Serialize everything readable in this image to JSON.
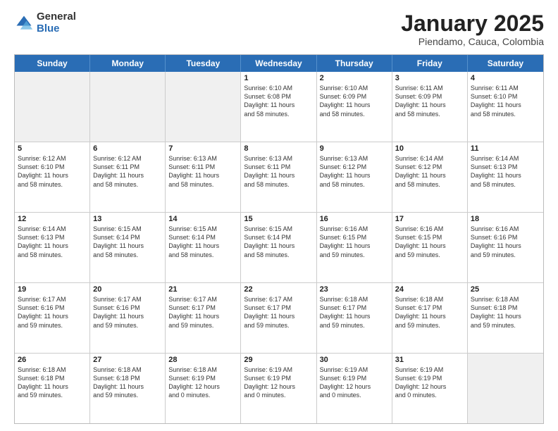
{
  "logo": {
    "general": "General",
    "blue": "Blue"
  },
  "title": {
    "month": "January 2025",
    "location": "Piendamo, Cauca, Colombia"
  },
  "header_days": [
    "Sunday",
    "Monday",
    "Tuesday",
    "Wednesday",
    "Thursday",
    "Friday",
    "Saturday"
  ],
  "weeks": [
    [
      {
        "day": "",
        "info": "",
        "shaded": true,
        "empty": true
      },
      {
        "day": "",
        "info": "",
        "shaded": true,
        "empty": true
      },
      {
        "day": "",
        "info": "",
        "shaded": true,
        "empty": true
      },
      {
        "day": "1",
        "info": "Sunrise: 6:10 AM\nSunset: 6:08 PM\nDaylight: 11 hours\nand 58 minutes."
      },
      {
        "day": "2",
        "info": "Sunrise: 6:10 AM\nSunset: 6:09 PM\nDaylight: 11 hours\nand 58 minutes."
      },
      {
        "day": "3",
        "info": "Sunrise: 6:11 AM\nSunset: 6:09 PM\nDaylight: 11 hours\nand 58 minutes."
      },
      {
        "day": "4",
        "info": "Sunrise: 6:11 AM\nSunset: 6:10 PM\nDaylight: 11 hours\nand 58 minutes."
      }
    ],
    [
      {
        "day": "5",
        "info": "Sunrise: 6:12 AM\nSunset: 6:10 PM\nDaylight: 11 hours\nand 58 minutes."
      },
      {
        "day": "6",
        "info": "Sunrise: 6:12 AM\nSunset: 6:11 PM\nDaylight: 11 hours\nand 58 minutes."
      },
      {
        "day": "7",
        "info": "Sunrise: 6:13 AM\nSunset: 6:11 PM\nDaylight: 11 hours\nand 58 minutes."
      },
      {
        "day": "8",
        "info": "Sunrise: 6:13 AM\nSunset: 6:11 PM\nDaylight: 11 hours\nand 58 minutes."
      },
      {
        "day": "9",
        "info": "Sunrise: 6:13 AM\nSunset: 6:12 PM\nDaylight: 11 hours\nand 58 minutes."
      },
      {
        "day": "10",
        "info": "Sunrise: 6:14 AM\nSunset: 6:12 PM\nDaylight: 11 hours\nand 58 minutes."
      },
      {
        "day": "11",
        "info": "Sunrise: 6:14 AM\nSunset: 6:13 PM\nDaylight: 11 hours\nand 58 minutes."
      }
    ],
    [
      {
        "day": "12",
        "info": "Sunrise: 6:14 AM\nSunset: 6:13 PM\nDaylight: 11 hours\nand 58 minutes."
      },
      {
        "day": "13",
        "info": "Sunrise: 6:15 AM\nSunset: 6:14 PM\nDaylight: 11 hours\nand 58 minutes."
      },
      {
        "day": "14",
        "info": "Sunrise: 6:15 AM\nSunset: 6:14 PM\nDaylight: 11 hours\nand 58 minutes."
      },
      {
        "day": "15",
        "info": "Sunrise: 6:15 AM\nSunset: 6:14 PM\nDaylight: 11 hours\nand 58 minutes."
      },
      {
        "day": "16",
        "info": "Sunrise: 6:16 AM\nSunset: 6:15 PM\nDaylight: 11 hours\nand 59 minutes."
      },
      {
        "day": "17",
        "info": "Sunrise: 6:16 AM\nSunset: 6:15 PM\nDaylight: 11 hours\nand 59 minutes."
      },
      {
        "day": "18",
        "info": "Sunrise: 6:16 AM\nSunset: 6:16 PM\nDaylight: 11 hours\nand 59 minutes."
      }
    ],
    [
      {
        "day": "19",
        "info": "Sunrise: 6:17 AM\nSunset: 6:16 PM\nDaylight: 11 hours\nand 59 minutes."
      },
      {
        "day": "20",
        "info": "Sunrise: 6:17 AM\nSunset: 6:16 PM\nDaylight: 11 hours\nand 59 minutes."
      },
      {
        "day": "21",
        "info": "Sunrise: 6:17 AM\nSunset: 6:17 PM\nDaylight: 11 hours\nand 59 minutes."
      },
      {
        "day": "22",
        "info": "Sunrise: 6:17 AM\nSunset: 6:17 PM\nDaylight: 11 hours\nand 59 minutes."
      },
      {
        "day": "23",
        "info": "Sunrise: 6:18 AM\nSunset: 6:17 PM\nDaylight: 11 hours\nand 59 minutes."
      },
      {
        "day": "24",
        "info": "Sunrise: 6:18 AM\nSunset: 6:17 PM\nDaylight: 11 hours\nand 59 minutes."
      },
      {
        "day": "25",
        "info": "Sunrise: 6:18 AM\nSunset: 6:18 PM\nDaylight: 11 hours\nand 59 minutes."
      }
    ],
    [
      {
        "day": "26",
        "info": "Sunrise: 6:18 AM\nSunset: 6:18 PM\nDaylight: 11 hours\nand 59 minutes."
      },
      {
        "day": "27",
        "info": "Sunrise: 6:18 AM\nSunset: 6:18 PM\nDaylight: 11 hours\nand 59 minutes."
      },
      {
        "day": "28",
        "info": "Sunrise: 6:18 AM\nSunset: 6:19 PM\nDaylight: 12 hours\nand 0 minutes."
      },
      {
        "day": "29",
        "info": "Sunrise: 6:19 AM\nSunset: 6:19 PM\nDaylight: 12 hours\nand 0 minutes."
      },
      {
        "day": "30",
        "info": "Sunrise: 6:19 AM\nSunset: 6:19 PM\nDaylight: 12 hours\nand 0 minutes."
      },
      {
        "day": "31",
        "info": "Sunrise: 6:19 AM\nSunset: 6:19 PM\nDaylight: 12 hours\nand 0 minutes."
      },
      {
        "day": "",
        "info": "",
        "shaded": true,
        "empty": true
      }
    ]
  ]
}
